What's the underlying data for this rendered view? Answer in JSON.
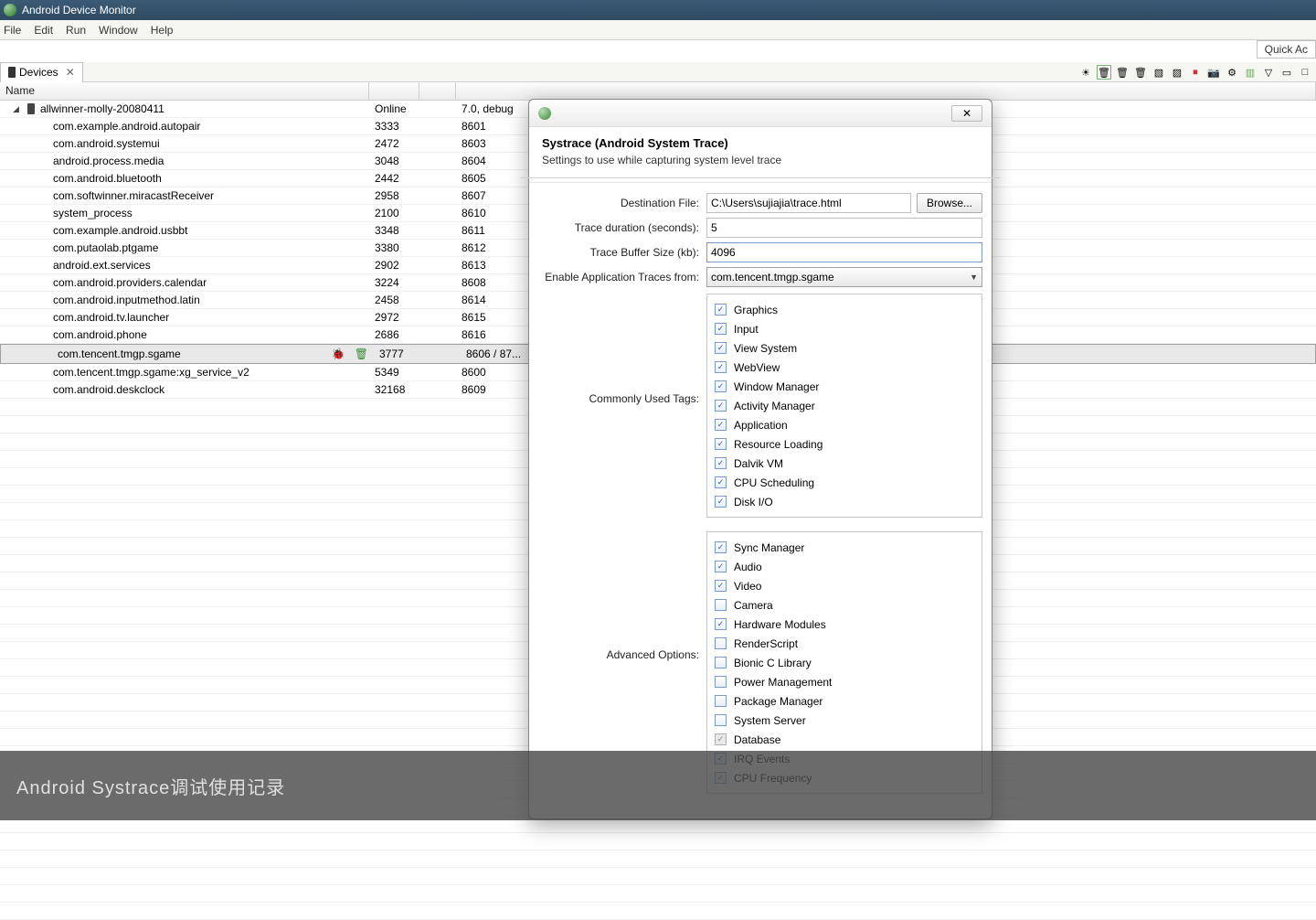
{
  "window": {
    "title": "Android Device Monitor"
  },
  "menu": [
    "File",
    "Edit",
    "Run",
    "Window",
    "Help"
  ],
  "quick_access": "Quick Ac",
  "devices": {
    "tab_label": "Devices",
    "header_name": "Name"
  },
  "device_tree": {
    "root": {
      "name": "allwinner-molly-20080411",
      "status": "Online",
      "version": "7.0, debug"
    },
    "processes": [
      {
        "name": "com.example.android.autopair",
        "pid": "3333",
        "port": "8601"
      },
      {
        "name": "com.android.systemui",
        "pid": "2472",
        "port": "8603"
      },
      {
        "name": "android.process.media",
        "pid": "3048",
        "port": "8604"
      },
      {
        "name": "com.android.bluetooth",
        "pid": "2442",
        "port": "8605"
      },
      {
        "name": "com.softwinner.miracastReceiver",
        "pid": "2958",
        "port": "8607"
      },
      {
        "name": "system_process",
        "pid": "2100",
        "port": "8610"
      },
      {
        "name": "com.example.android.usbbt",
        "pid": "3348",
        "port": "8611"
      },
      {
        "name": "com.putaolab.ptgame",
        "pid": "3380",
        "port": "8612"
      },
      {
        "name": "android.ext.services",
        "pid": "2902",
        "port": "8613"
      },
      {
        "name": "com.android.providers.calendar",
        "pid": "3224",
        "port": "8608"
      },
      {
        "name": "com.android.inputmethod.latin",
        "pid": "2458",
        "port": "8614"
      },
      {
        "name": "com.android.tv.launcher",
        "pid": "2972",
        "port": "8615"
      },
      {
        "name": "com.android.phone",
        "pid": "2686",
        "port": "8616"
      },
      {
        "name": "com.tencent.tmgp.sgame",
        "pid": "3777",
        "port": "8606 / 87...",
        "selected": true,
        "debug": true
      },
      {
        "name": "com.tencent.tmgp.sgame:xg_service_v2",
        "pid": "5349",
        "port": "8600"
      },
      {
        "name": "com.android.deskclock",
        "pid": "32168",
        "port": "8609"
      }
    ]
  },
  "dialog": {
    "title": "Systrace (Android System Trace)",
    "subtitle": "Settings to use while capturing system level trace",
    "labels": {
      "dest": "Destination File:",
      "duration": "Trace duration (seconds):",
      "buffer": "Trace Buffer Size (kb):",
      "enable": "Enable Application Traces from:",
      "common": "Commonly Used Tags:",
      "advanced": "Advanced Options:",
      "browse": "Browse..."
    },
    "values": {
      "dest": "C:\\Users\\sujiajia\\trace.html",
      "duration": "5",
      "buffer": "4096",
      "enable": "com.tencent.tmgp.sgame"
    },
    "common_tags": [
      {
        "l": "Graphics",
        "c": true
      },
      {
        "l": "Input",
        "c": true
      },
      {
        "l": "View System",
        "c": true
      },
      {
        "l": "WebView",
        "c": true
      },
      {
        "l": "Window Manager",
        "c": true
      },
      {
        "l": "Activity Manager",
        "c": true
      },
      {
        "l": "Application",
        "c": true
      },
      {
        "l": "Resource Loading",
        "c": true
      },
      {
        "l": "Dalvik VM",
        "c": true
      },
      {
        "l": "CPU Scheduling",
        "c": true
      },
      {
        "l": "Disk I/O",
        "c": true
      }
    ],
    "advanced_tags": [
      {
        "l": "Sync Manager",
        "c": true
      },
      {
        "l": "Audio",
        "c": true
      },
      {
        "l": "Video",
        "c": true
      },
      {
        "l": "Camera",
        "c": false
      },
      {
        "l": "Hardware Modules",
        "c": true
      },
      {
        "l": "RenderScript",
        "c": false
      },
      {
        "l": "Bionic C Library",
        "c": false
      },
      {
        "l": "Power Management",
        "c": false
      },
      {
        "l": "Package Manager",
        "c": false
      },
      {
        "l": "System Server",
        "c": false
      },
      {
        "l": "Database",
        "c": false,
        "d": true
      },
      {
        "l": "IRQ Events",
        "c": true
      },
      {
        "l": "CPU Frequency",
        "c": true
      }
    ]
  },
  "footer": "Android Systrace调试使用记录"
}
